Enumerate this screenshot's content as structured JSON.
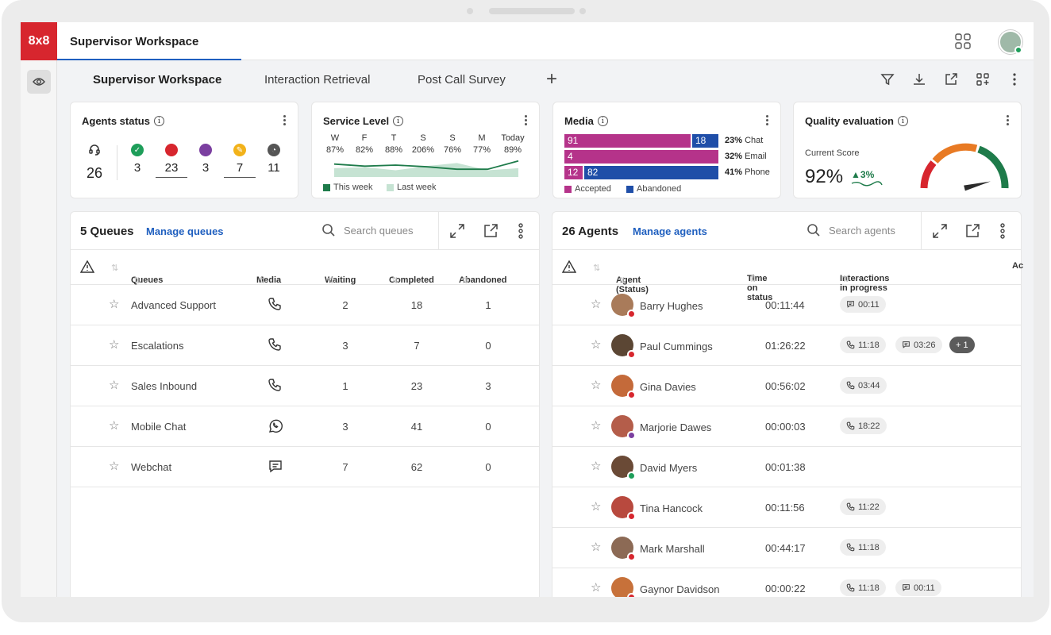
{
  "brand": {
    "logo": "8x8"
  },
  "topbar": {
    "title": "Supervisor Workspace"
  },
  "tabs": [
    {
      "label": "Supervisor Workspace",
      "active": true
    },
    {
      "label": "Interaction Retrieval",
      "active": false
    },
    {
      "label": "Post Call Survey",
      "active": false
    }
  ],
  "agents_status": {
    "title": "Agents status",
    "total": "26",
    "items": [
      {
        "icon": "available-check-icon",
        "color": "#1e9e5a",
        "value": "3"
      },
      {
        "icon": "busy-dot-icon",
        "color": "#d7262e",
        "value": "23"
      },
      {
        "icon": "on-break-dot-icon",
        "color": "#7b3fa0",
        "value": "3"
      },
      {
        "icon": "wrap-up-pencil-icon",
        "color": "#f2b21a",
        "value": "7"
      },
      {
        "icon": "offline-clock-icon",
        "color": "#555555",
        "value": "11"
      }
    ]
  },
  "service_level": {
    "title": "Service Level",
    "days": [
      "W",
      "F",
      "T",
      "S",
      "S",
      "M",
      "Today"
    ],
    "values": [
      "87%",
      "82%",
      "88%",
      "206%",
      "76%",
      "77%",
      "89%"
    ],
    "this_week": [
      0.55,
      0.45,
      0.5,
      0.42,
      0.3,
      0.3,
      0.7
    ],
    "last_week": [
      0.35,
      0.4,
      0.25,
      0.45,
      0.6,
      0.25,
      0.35
    ],
    "legend_this": "This week",
    "legend_last": "Last week",
    "color_this": "#1e7b4a",
    "color_last": "#c6e3d3"
  },
  "media": {
    "title": "Media",
    "rows": [
      {
        "accepted": "91",
        "abandoned": "18",
        "accepted_frac": 0.83,
        "pct": "23%",
        "label": "Chat"
      },
      {
        "accepted": "4",
        "abandoned": "",
        "accepted_frac": 1.0,
        "pct": "32%",
        "label": "Email"
      },
      {
        "accepted": "12",
        "abandoned": "82",
        "accepted_frac": 0.13,
        "pct": "41%",
        "label": "Phone"
      }
    ],
    "legend_accepted": "Accepted",
    "legend_abandoned": "Abandoned",
    "color_accepted": "#b5338a",
    "color_abandoned": "#1f4ea8"
  },
  "quality": {
    "title": "Quality evaluation",
    "current_label": "Current Score",
    "score": "92%",
    "delta": "3%",
    "score_value": 0.92
  },
  "queues": {
    "title": "5 Queues",
    "manage": "Manage queues",
    "search_placeholder": "Search queues",
    "headers": {
      "queues": "Queues",
      "media": "Media",
      "waiting": "Waiting",
      "completed": "Completed",
      "abandoned": "Abandoned"
    },
    "rows": [
      {
        "name": "Advanced Support",
        "media": "phone-icon",
        "waiting": "2",
        "completed": "18",
        "abandoned": "1"
      },
      {
        "name": "Escalations",
        "media": "phone-icon",
        "waiting": "3",
        "completed": "7",
        "abandoned": "0"
      },
      {
        "name": "Sales Inbound",
        "media": "phone-icon",
        "waiting": "1",
        "completed": "23",
        "abandoned": "3"
      },
      {
        "name": "Mobile Chat",
        "media": "whatsapp-icon",
        "waiting": "3",
        "completed": "41",
        "abandoned": "0"
      },
      {
        "name": "Webchat",
        "media": "chat-icon",
        "waiting": "7",
        "completed": "62",
        "abandoned": "0"
      }
    ]
  },
  "agents": {
    "title": "26 Agents",
    "manage": "Manage agents",
    "search_placeholder": "Search agents",
    "headers": {
      "agent": "Agent (Status)",
      "time": "Time on status",
      "interactions": "Interactions in progress",
      "extra": "Ac"
    },
    "rows": [
      {
        "name": "Barry Hughes",
        "time": "00:11:44",
        "status_color": "#d7262e",
        "avatar_color": "#a97b5a",
        "chips": [
          {
            "kind": "chat",
            "text": "00:11"
          }
        ]
      },
      {
        "name": "Paul Cummings",
        "time": "01:26:22",
        "status_color": "#d7262e",
        "avatar_color": "#5b4634",
        "chips": [
          {
            "kind": "phone",
            "text": "11:18"
          },
          {
            "kind": "chat",
            "text": "03:26"
          },
          {
            "kind": "more",
            "text": "+ 1"
          }
        ]
      },
      {
        "name": "Gina Davies",
        "time": "00:56:02",
        "status_color": "#d7262e",
        "avatar_color": "#c46a3a",
        "chips": [
          {
            "kind": "phone",
            "text": "03:44"
          }
        ]
      },
      {
        "name": "Marjorie Dawes",
        "time": "00:00:03",
        "status_color": "#7b3fa0",
        "avatar_color": "#b45d4a",
        "chips": [
          {
            "kind": "phone",
            "text": "18:22"
          }
        ]
      },
      {
        "name": "David Myers",
        "time": "00:01:38",
        "status_color": "#1e9e5a",
        "avatar_color": "#6a4a36",
        "chips": []
      },
      {
        "name": "Tina Hancock",
        "time": "00:11:56",
        "status_color": "#d7262e",
        "avatar_color": "#b8493e",
        "chips": [
          {
            "kind": "phone",
            "text": "11:22"
          }
        ]
      },
      {
        "name": "Mark Marshall",
        "time": "00:44:17",
        "status_color": "#d7262e",
        "avatar_color": "#8c6a55",
        "chips": [
          {
            "kind": "phone",
            "text": "11:18"
          }
        ]
      },
      {
        "name": "Gaynor Davidson",
        "time": "00:00:22",
        "status_color": "#d7262e",
        "avatar_color": "#c7713a",
        "chips": [
          {
            "kind": "phone",
            "text": "11:18"
          },
          {
            "kind": "chat",
            "text": "00:11"
          }
        ]
      }
    ]
  }
}
